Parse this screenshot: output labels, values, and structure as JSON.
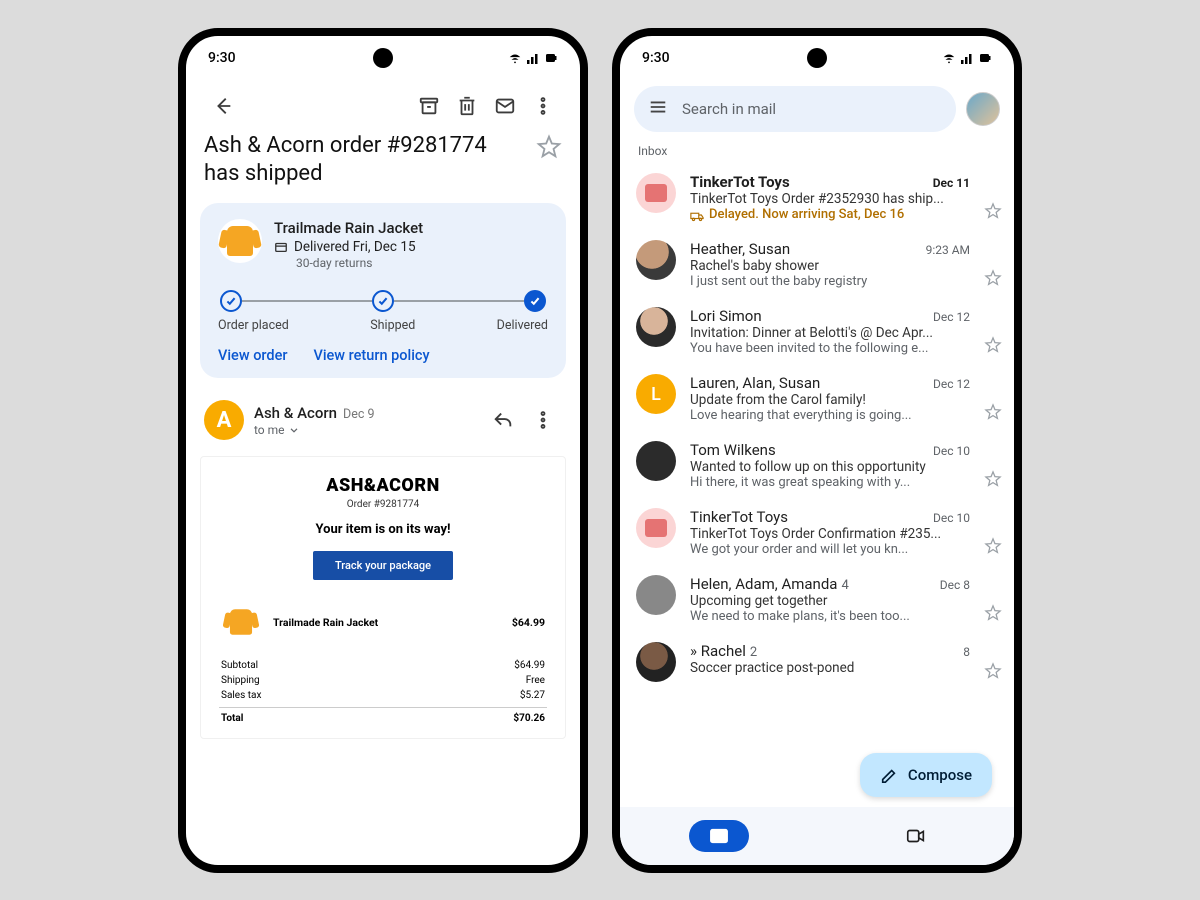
{
  "left": {
    "status_time": "9:30",
    "subject": "Ash & Acorn order #9281774 has shipped",
    "card": {
      "product": "Trailmade Rain Jacket",
      "delivery": "Delivered Fri, Dec 15",
      "returns": "30-day returns",
      "steps": [
        "Order placed",
        "Shipped",
        "Delivered"
      ],
      "view_order": "View order",
      "view_return": "View return policy"
    },
    "sender": {
      "name": "Ash & Acorn",
      "initial": "A",
      "date": "Dec 9",
      "to": "to me"
    },
    "body": {
      "brand": "ASH&ACORN",
      "order_label": "Order #9281774",
      "headline": "Your item is on its way!",
      "track_btn": "Track your package",
      "item_name": "Trailmade Rain Jacket",
      "item_price": "$64.99",
      "rows": [
        {
          "label": "Subtotal",
          "value": "$64.99"
        },
        {
          "label": "Shipping",
          "value": "Free"
        },
        {
          "label": "Sales tax",
          "value": "$5.27"
        }
      ],
      "total_label": "Total",
      "total_value": "$70.26"
    }
  },
  "right": {
    "status_time": "9:30",
    "search_placeholder": "Search in mail",
    "section": "Inbox",
    "compose": "Compose",
    "items": [
      {
        "from": "TinkerTot Toys",
        "date": "Dec 11",
        "subject": "TinkerTot Toys Order #2352930 has ship...",
        "status": "Delayed. Now arriving Sat, Dec 16",
        "bold": true,
        "avatar": "toy"
      },
      {
        "from": "Heather, Susan",
        "date": "9:23 AM",
        "subject": "Rachel's baby shower",
        "preview": "I just sent out the baby registry",
        "avatar": "img1"
      },
      {
        "from": "Lori Simon",
        "date": "Dec 12",
        "subject": "Invitation: Dinner at Belotti's @ Dec Apr...",
        "preview": "You have been invited to the following e...",
        "avatar": "img2"
      },
      {
        "from": "Lauren, Alan, Susan",
        "date": "Dec 12",
        "subject": "Update from the Carol family!",
        "preview": "Love hearing that everything is going...",
        "avatar": "orange",
        "initial": "L"
      },
      {
        "from": "Tom Wilkens",
        "date": "Dec 10",
        "subject": "Wanted to follow up on this opportunity",
        "preview": "Hi there, it was great speaking with y...",
        "avatar": "dark"
      },
      {
        "from": "TinkerTot Toys",
        "date": "Dec 10",
        "subject": "TinkerTot Toys Order Confirmation #235...",
        "preview": "We got your order and will let you kn...",
        "avatar": "toy"
      },
      {
        "from": "Helen, Adam, Amanda",
        "count": "4",
        "date": "Dec 8",
        "subject": "Upcoming get together",
        "preview": "We need to make plans, it's been too...",
        "avatar": "grey"
      },
      {
        "from": "Rachel",
        "count": "2",
        "prefix": "»",
        "date": "8",
        "subject": "Soccer practice post-poned",
        "preview": "",
        "avatar": "img3"
      }
    ]
  }
}
